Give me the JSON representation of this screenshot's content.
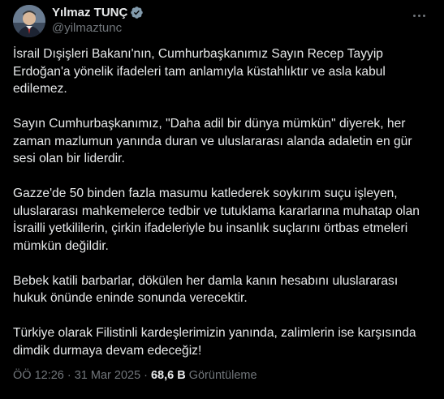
{
  "tweet": {
    "display_name": "Yılmaz TUNÇ",
    "handle": "@yilmaztunc",
    "paragraphs": [
      "İsrail Dışişleri Bakanı'nın, Cumhurbaşkanımız Sayın Recep Tayyip Erdoğan'a yönelik ifadeleri tam anlamıyla küstahlıktır ve asla kabul edilemez.",
      "Sayın Cumhurbaşkanımız, \"Daha adil bir dünya mümkün\" diyerek, her zaman mazlumun yanında duran ve uluslararası alanda adaletin en gür sesi olan bir liderdir.",
      "Gazze'de 50 binden fazla masumu katlederek soykırım suçu işleyen, uluslararası mahkemelerce tedbir ve tutuklama kararlarına muhatap olan İsrailli yetkililerin, çirkin ifadeleriyle bu insanlık suçlarını örtbas etmeleri mümkün değildir.",
      "Bebek katili barbarlar, dökülen her damla kanın hesabını uluslararası hukuk önünde eninde sonunda verecektir.",
      "Türkiye olarak Filistinli kardeşlerimizin yanında, zalimlerin ise karşısında dimdik durmaya devam edeceğiz!"
    ],
    "time": "ÖÖ 12:26",
    "date": "31 Mar 2025",
    "separator": "·",
    "views_count": "68,6 B",
    "views_label": "Görüntüleme"
  },
  "icons": {
    "verified": "verified-badge-icon",
    "more": "more-options-icon"
  },
  "colors": {
    "background": "#000000",
    "text": "#e7e9ea",
    "secondary": "#71767b",
    "verified": "#829aab"
  }
}
